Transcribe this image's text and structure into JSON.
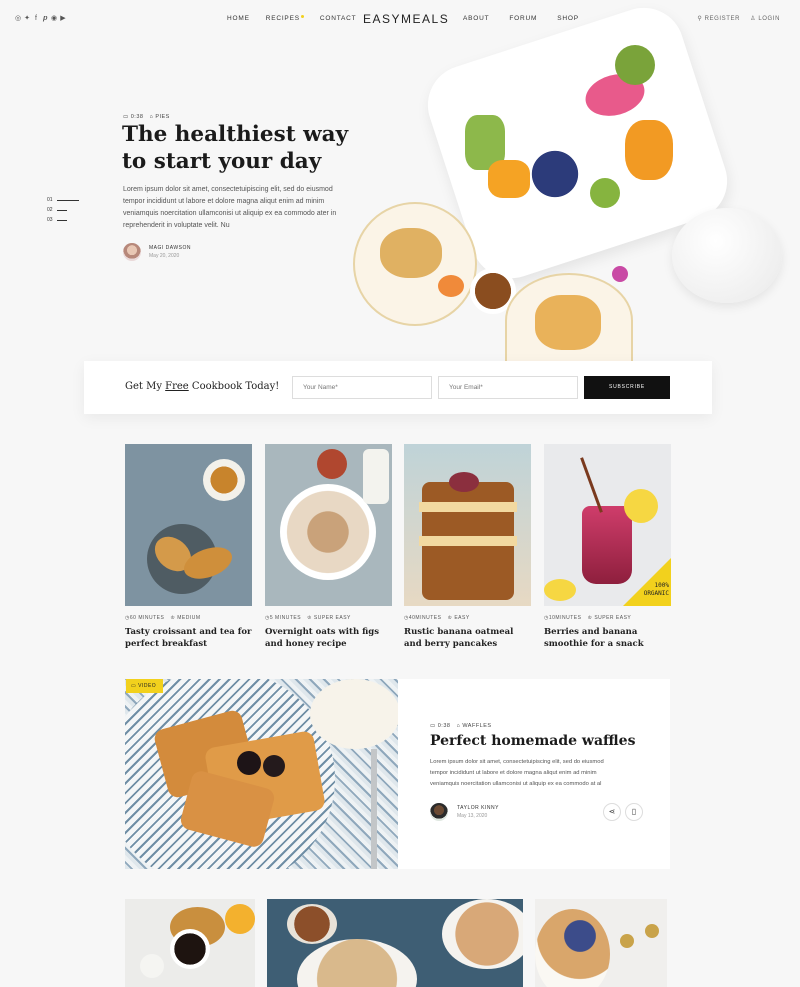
{
  "nav": {
    "social_icons": [
      "instagram-icon",
      "twitter-icon",
      "facebook-icon",
      "pinterest-icon",
      "rss-icon",
      "youtube-icon"
    ],
    "social_glyphs": [
      "◎",
      "✦",
      "f",
      "𝒑",
      "◉",
      "▶"
    ],
    "left": [
      "HOME",
      "RECIPES",
      "CONTACT"
    ],
    "brand": "EASYMEALS",
    "right": [
      "ABOUT",
      "FORUM",
      "SHOP"
    ],
    "register": "REGISTER",
    "login": "LOGIN",
    "accent_color": "#f2d11d"
  },
  "hero": {
    "time": "0:38",
    "category": "PIES",
    "title": "The healthiest way to start your day",
    "text": "Lorem ipsum dolor sit amet, consectetuipiscing elit, sed do eiusmod tempor incididunt ut labore et dolore magna aliqut enim ad minim veniamquis noercitation ullamconisi ut aliquip ex ea commodo ater in reprehenderit in voluptate velit. Nu",
    "author": "MAGI DAWSON",
    "date": "May 20, 2020",
    "slides": [
      "01",
      "02",
      "03"
    ]
  },
  "subscribe": {
    "title_before": "Get My ",
    "title_emph": "Free",
    "title_after": " Cookbook Today!",
    "name_placeholder": "Your Name*",
    "email_placeholder": "Your Email*",
    "button": "SUBSCRIBE"
  },
  "cards": [
    {
      "time": "60 MINUTES",
      "level": "MEDIUM",
      "title": "Tasty croissant and tea for perfect breakfast"
    },
    {
      "time": "5 MINUTES",
      "level": "SUPER EASY",
      "title": "Overnight oats with figs and honey recipe"
    },
    {
      "time": "40MINUTES",
      "level": "EASY",
      "title": "Rustic banana oatmeal and berry pancakes"
    },
    {
      "time": "10MINUTES",
      "level": "SUPER EASY",
      "title": "Berries and banana smoothie for a snack",
      "badge": "100% ORGANIC"
    }
  ],
  "featured": {
    "tag": "VIDEO",
    "time": "0:38",
    "category": "WAFFLES",
    "title": "Perfect homemade waffles",
    "text": "Lorem ipsum dolor sit amet, consectetuipiscing elit, sed do eiusmod tempor incididunt ut labore et dolore magna aliqut enim ad minim veniamquis noercitation ullamconisi ut aliquip ex ea commodo at al",
    "author": "TAYLOR KINNY",
    "date": "May 13, 2020"
  }
}
